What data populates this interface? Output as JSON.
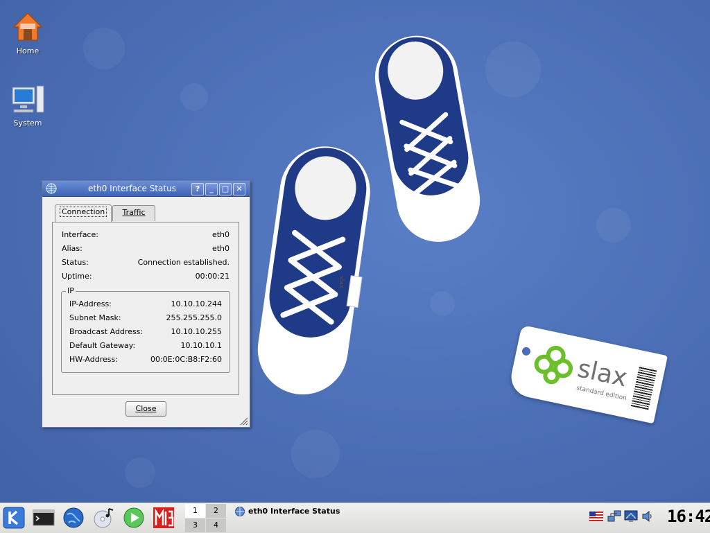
{
  "desktop": {
    "icons": [
      {
        "label": "Home"
      },
      {
        "label": "System"
      }
    ],
    "slax_tag": {
      "brand": "slax",
      "edition": "standard edition"
    },
    "shoe_tag": "slax"
  },
  "window": {
    "title": "eth0 Interface Status",
    "buttons": {
      "help": "?",
      "minimize": "_",
      "maximize": "□",
      "close": "✕"
    },
    "tabs": [
      {
        "label": "Connection",
        "active": true
      },
      {
        "label": "Traffic",
        "active": false
      }
    ],
    "fields": [
      {
        "label": "Interface:",
        "value": "eth0"
      },
      {
        "label": "Alias:",
        "value": "eth0"
      },
      {
        "label": "Status:",
        "value": "Connection established."
      },
      {
        "label": "Uptime:",
        "value": "00:00:21"
      }
    ],
    "ip_group": {
      "title": "IP",
      "fields": [
        {
          "label": "IP-Address:",
          "value": "10.10.10.244"
        },
        {
          "label": "Subnet Mask:",
          "value": "255.255.255.0"
        },
        {
          "label": "Broadcast Address:",
          "value": "10.10.10.255"
        },
        {
          "label": "Default Gateway:",
          "value": "10.10.10.1"
        },
        {
          "label": "HW-Address:",
          "value": "00:0E:0C:B8:F2:60"
        }
      ]
    },
    "close_label": "Close"
  },
  "taskbar": {
    "launchers": [
      "kde-menu-icon",
      "terminal-icon",
      "browser-globe-icon",
      "media-cd-icon",
      "player-play-icon",
      "mib-icon"
    ],
    "pager": [
      "1",
      "2",
      "3",
      "4"
    ],
    "active_desktop": "1",
    "task": {
      "label": "eth0 Interface Status"
    },
    "tray": [
      "us-flag-icon",
      "network-icon",
      "display-icon",
      "volume-icon"
    ],
    "clock": "16:42"
  },
  "colors": {
    "desktop_bg": "#4a6db4",
    "titlebar": "#4a6ec2",
    "slax_green": "#6abf2a"
  }
}
